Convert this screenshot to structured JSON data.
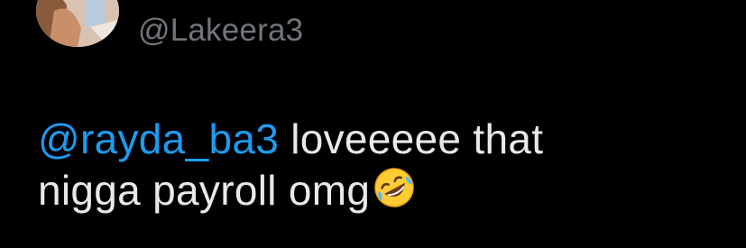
{
  "tweet": {
    "handle": "@Lakeera3",
    "mention": "@rayda_ba3",
    "text_line1": " loveeeee that",
    "text_line2": "nigga payroll omg",
    "emoji": "rolling-on-the-floor-laughing"
  },
  "colors": {
    "background": "#000000",
    "handle": "#71767b",
    "text": "#e7e9ea",
    "mention": "#1d9bf0"
  }
}
